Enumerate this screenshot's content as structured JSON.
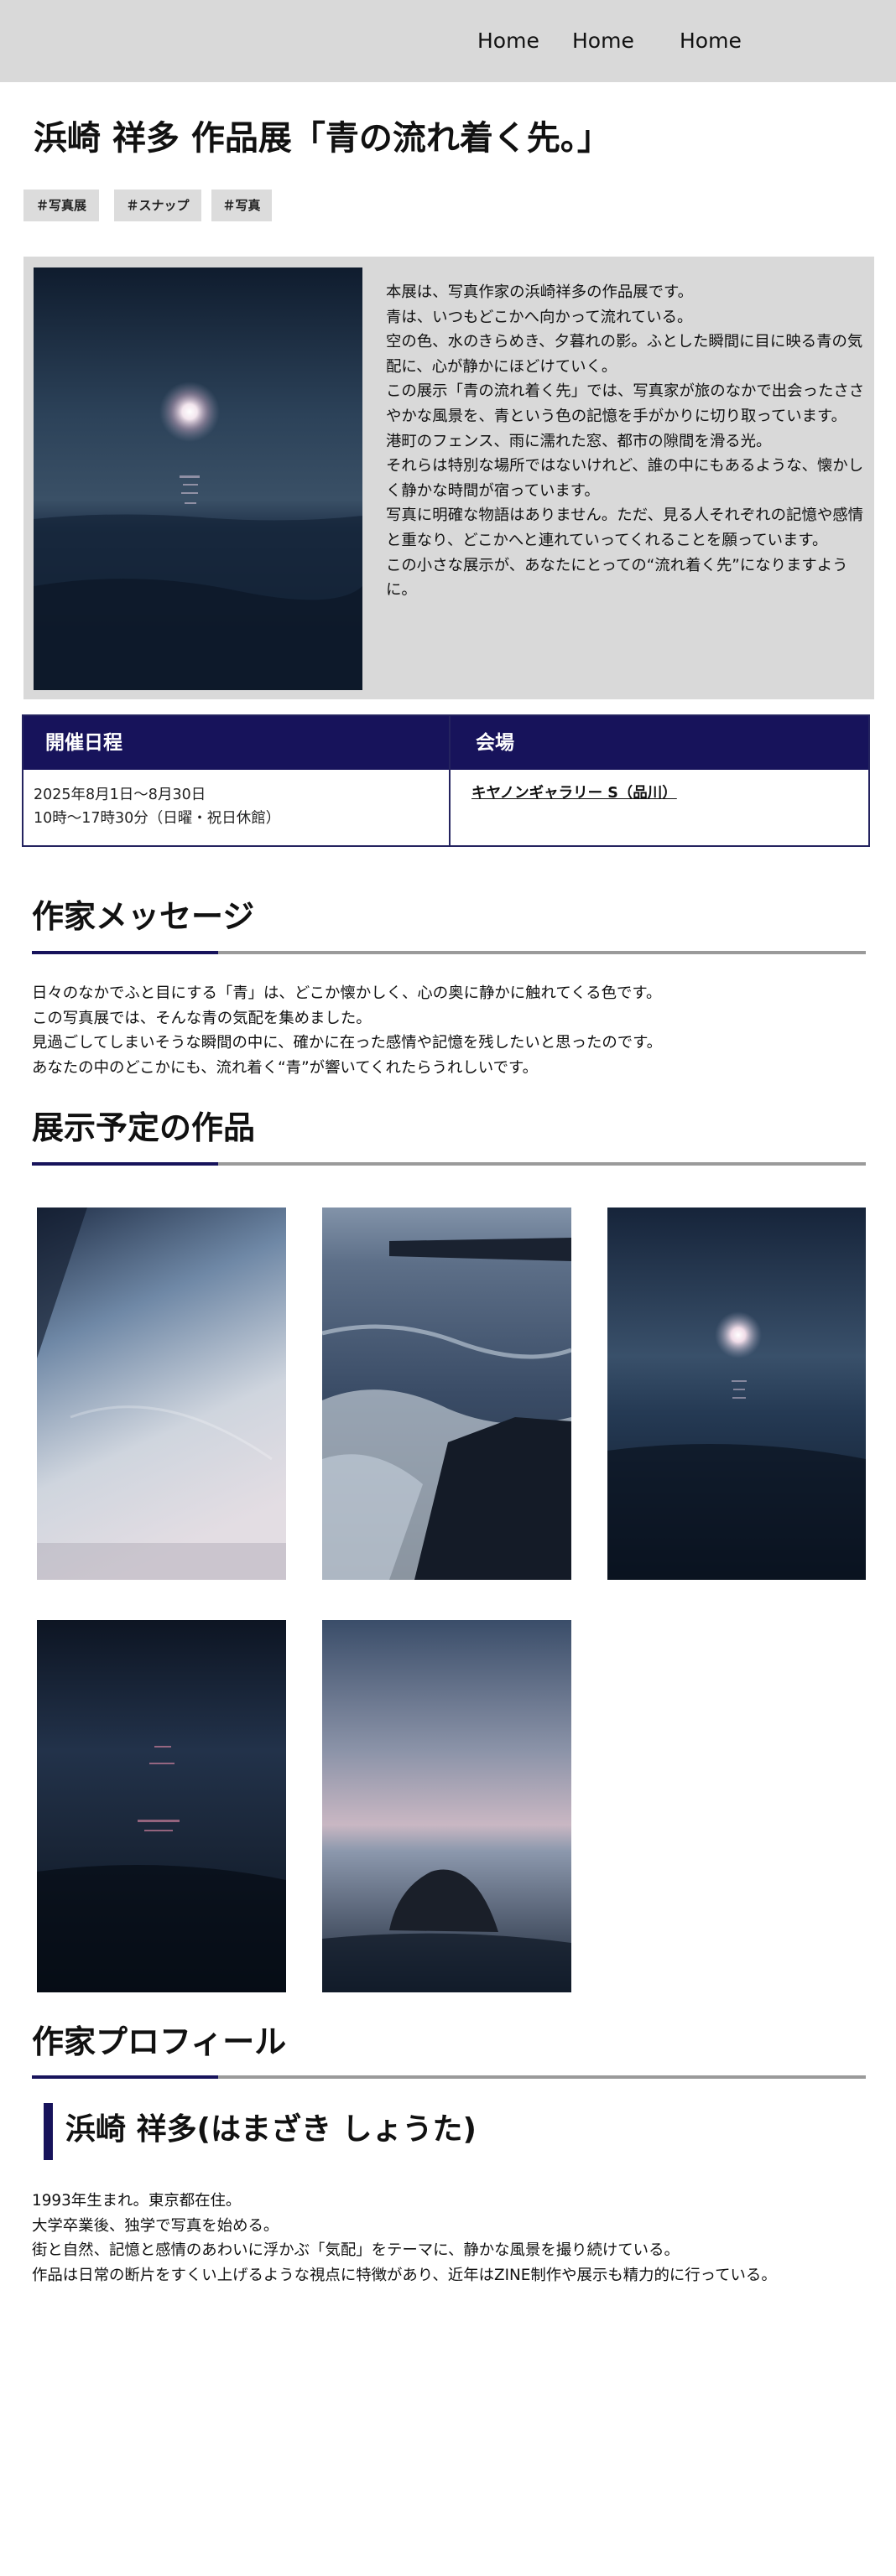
{
  "nav": {
    "items": [
      "Home",
      "Home",
      "Home"
    ]
  },
  "page": {
    "title": "浜崎 祥多 作品展「青の流れ着く先。」"
  },
  "tags": [
    "＃写真展",
    "＃スナップ",
    "＃写真"
  ],
  "intro": {
    "paragraphs": [
      "本展は、写真作家の浜崎祥多の作品展です。",
      "青は、いつもどこかへ向かって流れている。",
      "空の色、水のきらめき、夕暮れの影。ふとした瞬間に目に映る青の気配に、心が静かにほどけていく。",
      "この展示「青の流れ着く先」では、写真家が旅のなかで出会ったささやかな風景を、青という色の記憶を手がかりに切り取っています。",
      "港町のフェンス、雨に濡れた窓、都市の隙間を滑る光。",
      "それらは特別な場所ではないけれど、誰の中にもあるような、懐かしく静かな時間が宿っています。",
      "写真に明確な物語はありません。ただ、見る人それぞれの記憶や感情と重なり、どこかへと連れていってくれることを願っています。",
      "この小さな展示が、あなたにとっての“流れ着く先”になりますように。"
    ]
  },
  "info": {
    "date_label": "開催日程",
    "venue_label": "会場",
    "date_line1": "2025年8月1日〜8月30日",
    "date_line2": "10時〜17時30分（日曜・祝日休館）",
    "venue": "キヤノンギャラリー S（品川）"
  },
  "message": {
    "heading": "作家メッセージ",
    "paragraphs": [
      "日々のなかでふと目にする「青」は、どこか懐かしく、心の奥に静かに触れてくる色です。",
      "この写真展では、そんな青の気配を集めました。",
      "見過ごしてしまいそうな瞬間の中に、確かに在った感情や記憶を残したいと思ったのです。",
      "あなたの中のどこかにも、流れ着く“青”が響いてくれたらうれしいです。"
    ]
  },
  "works": {
    "heading": "展示予定の作品",
    "items": [
      {
        "subject": "hazy-sky-photo"
      },
      {
        "subject": "breakwater-waves-photo"
      },
      {
        "subject": "moon-over-sea-photo"
      },
      {
        "subject": "dark-sea-reflection-photo"
      },
      {
        "subject": "rock-at-dusk-photo"
      }
    ]
  },
  "profile": {
    "heading": "作家プロフィール",
    "name": "浜崎 祥多(はまざき しょうた)",
    "bio": [
      "1993年生まれ。東京都在住。",
      "大学卒業後、独学で写真を始める。",
      "街と自然、記憶と感情のあわいに浮かぶ「気配」をテーマに、静かな風景を撮り続けている。",
      "作品は日常の断片をすくい上げるような視点に特徴があり、近年はZINE制作や展示も精力的に行っている。"
    ]
  },
  "colors": {
    "header_bg": "#d9d9d9",
    "accent_navy": "#17135b",
    "tag_bg": "#dcdcdc",
    "rule_gray": "#9a9a9a"
  }
}
